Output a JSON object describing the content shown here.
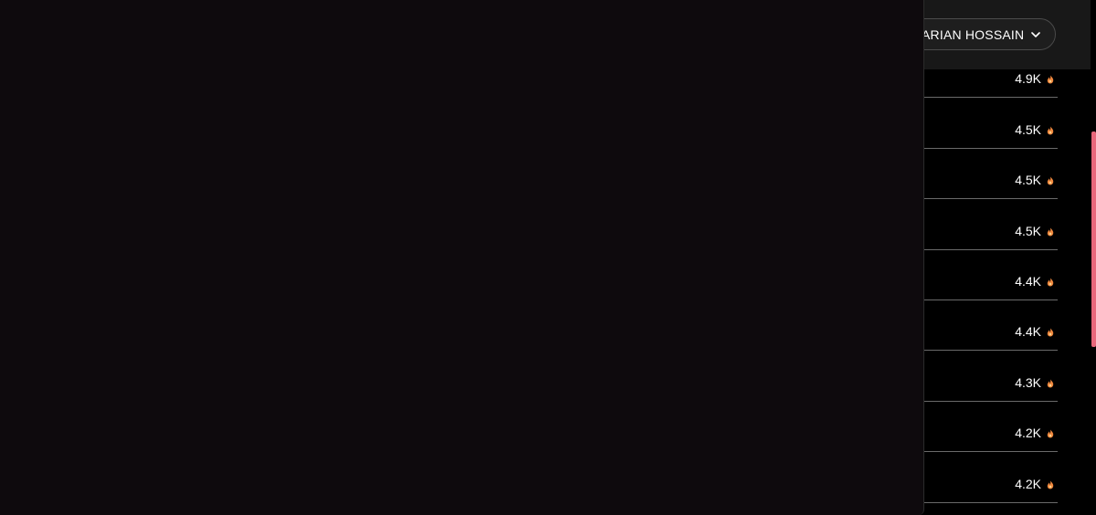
{
  "header": {
    "user_name": "ARIAN HOSSAIN",
    "chevron_icon": "chevron-down-icon"
  },
  "rows": [
    {
      "value": "4.9K",
      "icon": "fire-icon"
    },
    {
      "value": "4.5K",
      "icon": "fire-icon"
    },
    {
      "value": "4.5K",
      "icon": "fire-icon"
    },
    {
      "value": "4.5K",
      "icon": "fire-icon"
    },
    {
      "value": "4.4K",
      "icon": "fire-icon"
    },
    {
      "value": "4.4K",
      "icon": "fire-icon"
    },
    {
      "value": "4.3K",
      "icon": "fire-icon"
    },
    {
      "value": "4.2K",
      "icon": "fire-icon"
    },
    {
      "value": "4.2K",
      "icon": "fire-icon"
    }
  ],
  "colors": {
    "background": "#000000",
    "header": "#181818",
    "modal": "#0e0a0d",
    "scrollbar": "#e8677b",
    "fire_icon": "#f0883e"
  }
}
